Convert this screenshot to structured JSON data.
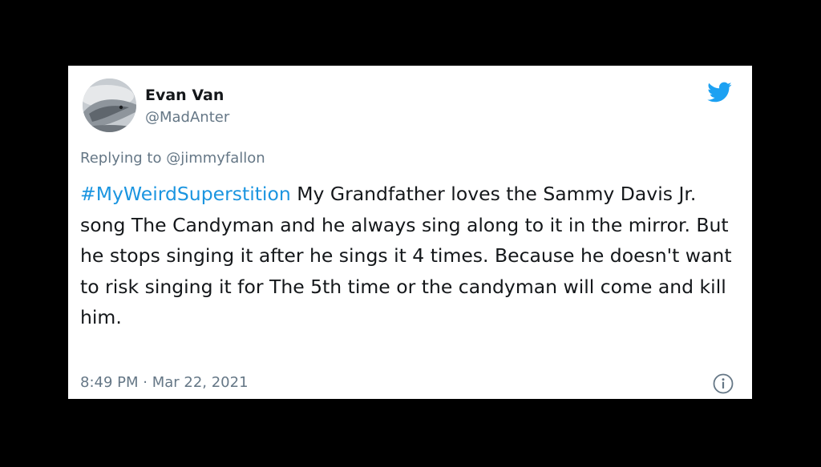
{
  "user": {
    "name": "Evan Van",
    "handle": "@MadAnter"
  },
  "replying_to": "Replying to @jimmyfallon",
  "tweet": {
    "hashtag": "#MyWeirdSuperstition",
    "body": " My Grandfather loves the Sammy Davis Jr. song The Candyman and he always sing along to it in the mirror. But he stops singing it after he sings it 4 times. Because he doesn't want to risk singing it for The 5th time or the candyman will come and kill him."
  },
  "timestamp": "8:49 PM · Mar 22, 2021",
  "icons": {
    "brand": "twitter-bird-icon",
    "info": "info-icon"
  },
  "colors": {
    "hashtag": "#1b95e0",
    "brand": "#1da1f2",
    "secondary_text": "#657786"
  }
}
